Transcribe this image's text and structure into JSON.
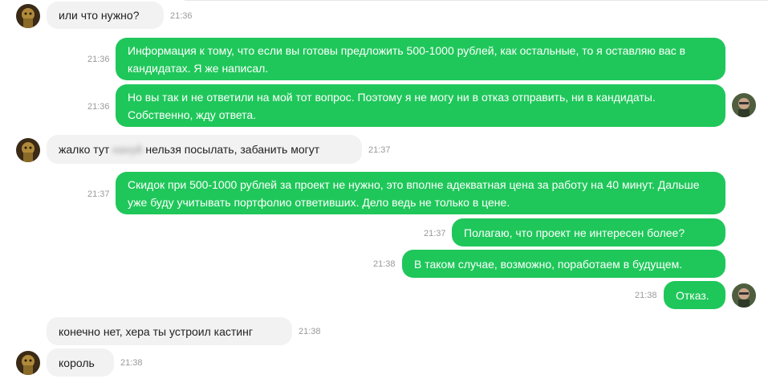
{
  "colors": {
    "outgoing_bubble": "#1fc75a",
    "incoming_bubble": "#f2f2f2",
    "time_text": "#9a9a9a"
  },
  "messages": [
    {
      "text": "или что нужно?",
      "time": "21:36"
    },
    {
      "text": "Информация к тому, что если вы готовы предложить 500-1000 рублей, как остальные, то я оставляю вас в кандидатах. Я же написал.",
      "time": "21:36"
    },
    {
      "text": "Но вы так и не ответили на мой тот вопрос. Поэтому я не могу ни в отказ отправить, ни в кандидаты. Собственно, жду ответа.",
      "time": "21:36"
    },
    {
      "text_before": "жалко тут ",
      "text_blurred": "нахуй",
      "text_after": " нельзя посылать, забанить могут",
      "time": "21:37"
    },
    {
      "text": "Скидок при 500-1000 рублей за проект не нужно, это вполне адекватная цена за работу на 40 минут. Дальше уже буду учитывать портфолио ответивших. Дело ведь не только в цене.",
      "time": "21:37"
    },
    {
      "text": "Полагаю, что проект не интересен более?",
      "time": "21:37"
    },
    {
      "text": "В таком случае, возможно, поработаем в будущем.",
      "time": "21:38"
    },
    {
      "text": "Отказ.",
      "time": "21:38"
    },
    {
      "text": "конечно нет, хера ты устроил кастинг",
      "time": "21:38"
    },
    {
      "text": "король",
      "time": "21:38"
    }
  ]
}
